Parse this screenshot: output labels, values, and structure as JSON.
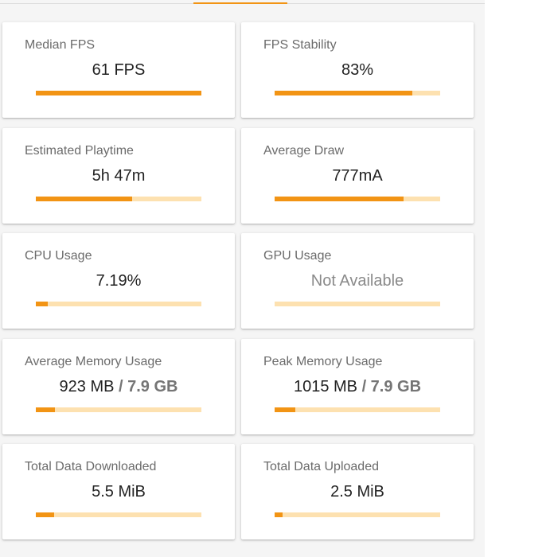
{
  "colors": {
    "accent": "#f29414",
    "track": "#fde1b0",
    "background": "#f5f5f5",
    "card": "#ffffff"
  },
  "cards": [
    {
      "title": "Median FPS",
      "value": "61 FPS",
      "total": "",
      "progress": 1.0,
      "muted": false
    },
    {
      "title": "FPS Stability",
      "value": "83%",
      "total": "",
      "progress": 0.83,
      "muted": false
    },
    {
      "title": "Estimated Playtime",
      "value": "5h 47m",
      "total": "",
      "progress": 0.58,
      "muted": false
    },
    {
      "title": "Average Draw",
      "value": "777mA",
      "total": "",
      "progress": 0.78,
      "muted": false
    },
    {
      "title": "CPU Usage",
      "value": "7.19%",
      "total": "",
      "progress": 0.072,
      "muted": false
    },
    {
      "title": "GPU Usage",
      "value": "Not Available",
      "total": "",
      "progress": 0.0,
      "muted": true
    },
    {
      "title": "Average Memory Usage",
      "value": "923 MB",
      "total": " / 7.9 GB",
      "progress": 0.114,
      "muted": false
    },
    {
      "title": "Peak Memory Usage",
      "value": "1015 MB",
      "total": " / 7.9 GB",
      "progress": 0.126,
      "muted": false
    },
    {
      "title": "Total Data Downloaded",
      "value": "5.5 MiB",
      "total": "",
      "progress": 0.11,
      "muted": false
    },
    {
      "title": "Total Data Uploaded",
      "value": "2.5 MiB",
      "total": "",
      "progress": 0.05,
      "muted": false
    }
  ]
}
